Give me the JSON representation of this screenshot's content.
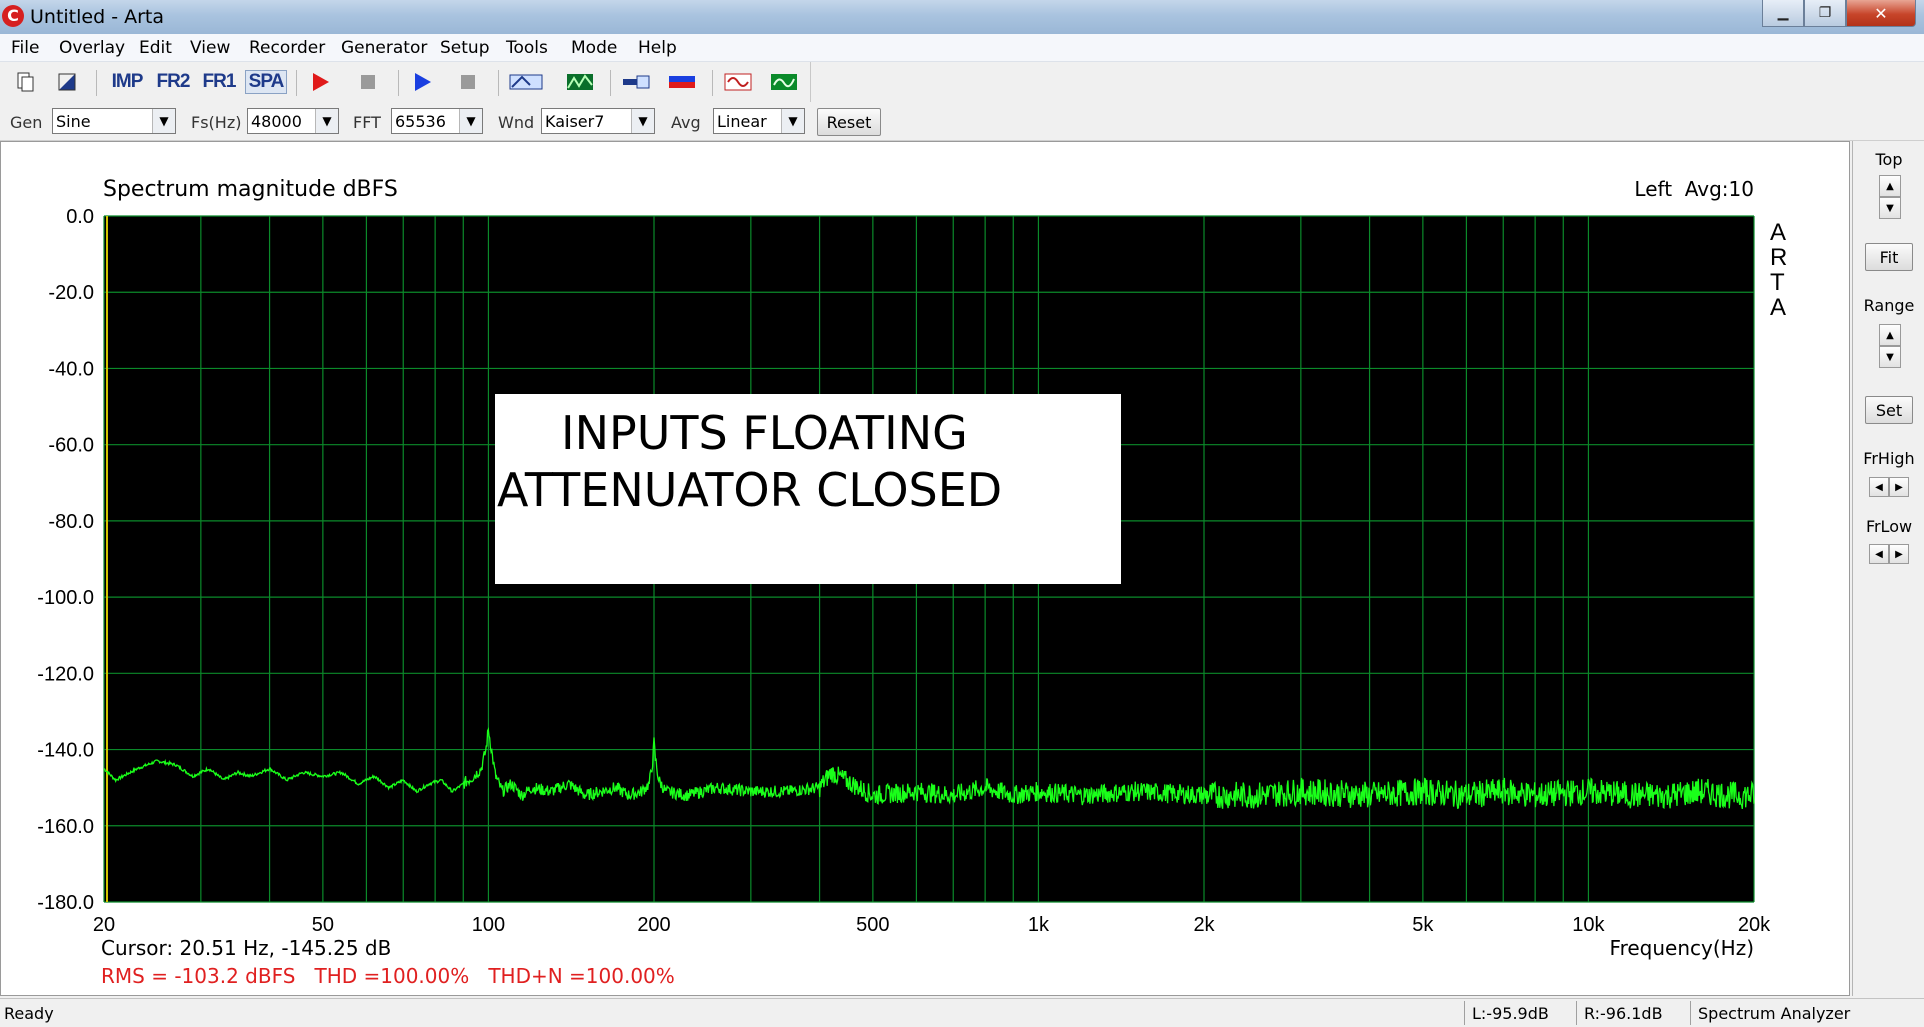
{
  "window": {
    "title": "Untitled - Arta",
    "logo": "C",
    "minimize": "▁",
    "maximize": "❐",
    "close": "✕"
  },
  "menu": [
    "File",
    "Overlay",
    "Edit",
    "View",
    "Recorder",
    "Generator",
    "Setup",
    "Tools",
    "Mode",
    "Help"
  ],
  "toolbar": {
    "modes": [
      "IMP",
      "FR2",
      "FR1",
      "SPA"
    ],
    "active_mode": "SPA",
    "icons": [
      "new-file-icon",
      "open-file-icon",
      "imp-mode-icon",
      "fr2-mode-icon",
      "fr1-mode-icon",
      "spa-mode-icon",
      "record-icon",
      "stop-icon",
      "play-icon",
      "stop-play-icon",
      "label-abc-icon",
      "waterfall-icon",
      "calibrate-icon",
      "level-meter-icon",
      "generator-wave-icon",
      "scope-icon"
    ]
  },
  "controls": {
    "gen_label": "Gen",
    "gen_value": "Sine",
    "fs_label": "Fs(Hz)",
    "fs_value": "48000",
    "fft_label": "FFT",
    "fft_value": "65536",
    "wnd_label": "Wnd",
    "wnd_value": "Kaiser7",
    "avg_label": "Avg",
    "avg_value": "Linear",
    "reset_label": "Reset"
  },
  "right_panel": {
    "top_label": "Top",
    "fit_label": "Fit",
    "range_label": "Range",
    "set_label": "Set",
    "frhigh_label": "FrHigh",
    "frlow_label": "FrLow"
  },
  "plot": {
    "title": "Spectrum magnitude dBFS",
    "channel_info": "Left  Avg:10",
    "watermark": [
      "A",
      "R",
      "T",
      "A"
    ],
    "annotation": [
      "INPUTS FLOATING",
      "ATTENUATOR CLOSED"
    ],
    "cursor": "Cursor: 20.51 Hz, -145.25 dB",
    "measurements": "RMS = -103.2 dBFS   THD =100.00%   THD+N =100.00%",
    "xlabel": "Frequency(Hz)",
    "colors": {
      "background": "#000000",
      "grid": "#0b8a2a",
      "trace": "#1aff1a",
      "measure_text": "#e02020"
    }
  },
  "chart_data": {
    "type": "line",
    "title": "Spectrum magnitude dBFS",
    "xlabel": "Frequency(Hz)",
    "ylabel": "",
    "xscale": "log",
    "xlim": [
      20,
      20000
    ],
    "ylim": [
      -180,
      0
    ],
    "grid": true,
    "x_ticks": [
      20,
      50,
      100,
      200,
      500,
      1000,
      2000,
      5000,
      10000,
      20000
    ],
    "x_tick_labels": [
      "20",
      "50",
      "100",
      "200",
      "500",
      "1k",
      "2k",
      "5k",
      "10k",
      "20k"
    ],
    "y_ticks": [
      0,
      -20,
      -40,
      -60,
      -80,
      -100,
      -120,
      -140,
      -160,
      -180
    ],
    "y_tick_labels": [
      "0.0",
      "-20.0",
      "-40.0",
      "-60.0",
      "-80.0",
      "-100.0",
      "-120.0",
      "-140.0",
      "-160.0",
      "-180.0"
    ],
    "series": [
      {
        "x": [
          20,
          21,
          23,
          25,
          27,
          29,
          31,
          33,
          35,
          37,
          40,
          43,
          46,
          50,
          54,
          58,
          62,
          66,
          70,
          74,
          78,
          82,
          86,
          90,
          94,
          97,
          99,
          100,
          101,
          103,
          106,
          110,
          115,
          120,
          130,
          140,
          150,
          160,
          170,
          180,
          190,
          196,
          199,
          200,
          201,
          204,
          210,
          230,
          260,
          300,
          350,
          400,
          420,
          500,
          600,
          700,
          800,
          900,
          1000,
          1200,
          1500,
          2000,
          2500,
          3000,
          4000,
          5000,
          6000,
          7000,
          8000,
          10000,
          12000,
          14000,
          16000,
          18000,
          20000
        ],
        "y": [
          -145,
          -148,
          -145,
          -143,
          -144,
          -147,
          -145,
          -148,
          -146,
          -147,
          -145,
          -148,
          -146,
          -147,
          -146,
          -149,
          -147,
          -150,
          -148,
          -151,
          -149,
          -148,
          -151,
          -149,
          -147,
          -145,
          -140,
          -134.5,
          -139,
          -147,
          -151,
          -149,
          -152,
          -150,
          -151,
          -149,
          -152,
          -151,
          -150,
          -152,
          -151,
          -149,
          -143,
          -138,
          -142,
          -148,
          -151,
          -152,
          -150,
          -151,
          -151,
          -150,
          -146,
          -152,
          -151,
          -152,
          -150,
          -152,
          -151,
          -152,
          -151,
          -152,
          -152,
          -151,
          -152,
          -151,
          -152,
          -151,
          -152,
          -151,
          -152,
          -152,
          -151,
          -152,
          -152
        ]
      }
    ]
  },
  "status": {
    "ready": "Ready",
    "left_level": "L:-95.9dB",
    "right_level": "R:-96.1dB",
    "mode": "Spectrum Analyzer"
  }
}
